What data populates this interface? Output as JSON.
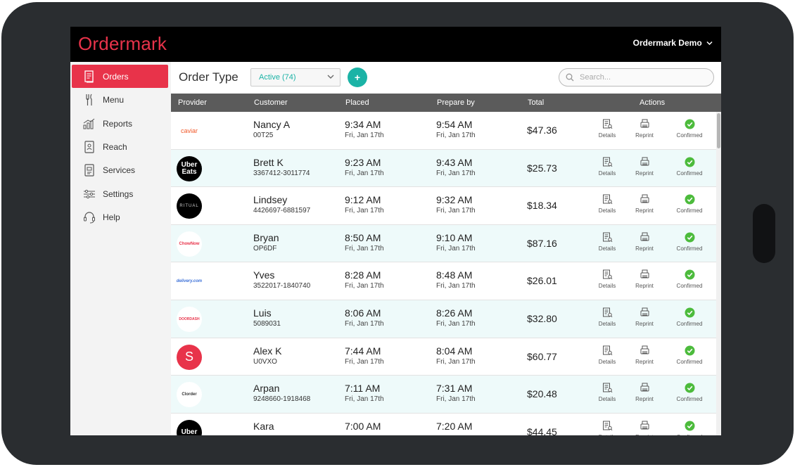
{
  "colors": {
    "brand": "#e8334a",
    "accent": "#1bb3a6",
    "header_bg": "#000000",
    "table_header_bg": "#5b5b5b",
    "row_alt": "#eefafa",
    "confirmed": "#4cbb3c"
  },
  "header": {
    "logo": "Ordermark",
    "account": "Ordermark Demo"
  },
  "sidebar": {
    "items": [
      {
        "label": "Orders",
        "icon": "orders-icon",
        "active": true
      },
      {
        "label": "Menu",
        "icon": "fork-knife-icon",
        "active": false
      },
      {
        "label": "Reports",
        "icon": "bar-chart-icon",
        "active": false
      },
      {
        "label": "Reach",
        "icon": "reach-icon",
        "active": false
      },
      {
        "label": "Services",
        "icon": "services-icon",
        "active": false
      },
      {
        "label": "Settings",
        "icon": "sliders-icon",
        "active": false
      },
      {
        "label": "Help",
        "icon": "headset-icon",
        "active": false
      }
    ],
    "collapse_icon": "chevron-left-icon"
  },
  "toolbar": {
    "title": "Order Type",
    "filter_value": "Active (74)",
    "add_label": "+",
    "search_placeholder": "Search..."
  },
  "table": {
    "columns": [
      "Provider",
      "Customer",
      "Placed",
      "Prepare by",
      "Total",
      "Actions"
    ],
    "action_labels": {
      "details": "Details",
      "reprint": "Reprint",
      "confirmed": "Confirmed"
    },
    "rows": [
      {
        "provider": "caviar",
        "provider_text": "caviar",
        "customer": "Nancy A",
        "order_id": "00T25",
        "placed_time": "9:34 AM",
        "placed_date": "Fri, Jan 17th",
        "prepare_time": "9:54 AM",
        "prepare_date": "Fri, Jan 17th",
        "total": "$47.36"
      },
      {
        "provider": "uber-eats",
        "provider_text": "Uber Eats",
        "customer": "Brett K",
        "order_id": "3367412-3011774",
        "placed_time": "9:23 AM",
        "placed_date": "Fri, Jan 17th",
        "prepare_time": "9:43 AM",
        "prepare_date": "Fri, Jan 17th",
        "total": "$25.73"
      },
      {
        "provider": "ritual",
        "provider_text": "RITUAL",
        "customer": "Lindsey",
        "order_id": "4426697-6881597",
        "placed_time": "9:12 AM",
        "placed_date": "Fri, Jan 17th",
        "prepare_time": "9:32 AM",
        "prepare_date": "Fri, Jan 17th",
        "total": "$18.34"
      },
      {
        "provider": "chownow",
        "provider_text": "ChowNow",
        "customer": "Bryan",
        "order_id": "OP6DF",
        "placed_time": "8:50 AM",
        "placed_date": "Fri, Jan 17th",
        "prepare_time": "9:10 AM",
        "prepare_date": "Fri, Jan 17th",
        "total": "$87.16"
      },
      {
        "provider": "delivery-com",
        "provider_text": "delivery.com",
        "customer": "Yves",
        "order_id": "3522017-1840740",
        "placed_time": "8:28 AM",
        "placed_date": "Fri, Jan 17th",
        "prepare_time": "8:48 AM",
        "prepare_date": "Fri, Jan 17th",
        "total": "$26.01"
      },
      {
        "provider": "doordash",
        "provider_text": "DOORDASH",
        "customer": "Luis",
        "order_id": "5089031",
        "placed_time": "8:06 AM",
        "placed_date": "Fri, Jan 17th",
        "prepare_time": "8:26 AM",
        "prepare_date": "Fri, Jan 17th",
        "total": "$32.80"
      },
      {
        "provider": "square",
        "provider_text": "S",
        "customer": "Alex K",
        "order_id": "U0VXO",
        "placed_time": "7:44 AM",
        "placed_date": "Fri, Jan 17th",
        "prepare_time": "8:04 AM",
        "prepare_date": "Fri, Jan 17th",
        "total": "$60.77"
      },
      {
        "provider": "cloud-order",
        "provider_text": "Clorder",
        "customer": "Arpan",
        "order_id": "9248660-1918468",
        "placed_time": "7:11 AM",
        "placed_date": "Fri, Jan 17th",
        "prepare_time": "7:31 AM",
        "prepare_date": "Fri, Jan 17th",
        "total": "$20.48"
      },
      {
        "provider": "uber-eats",
        "provider_text": "Uber",
        "customer": "Kara",
        "order_id": "",
        "placed_time": "7:00 AM",
        "placed_date": "",
        "prepare_time": "7:20 AM",
        "prepare_date": "",
        "total": "$44.45"
      }
    ]
  }
}
